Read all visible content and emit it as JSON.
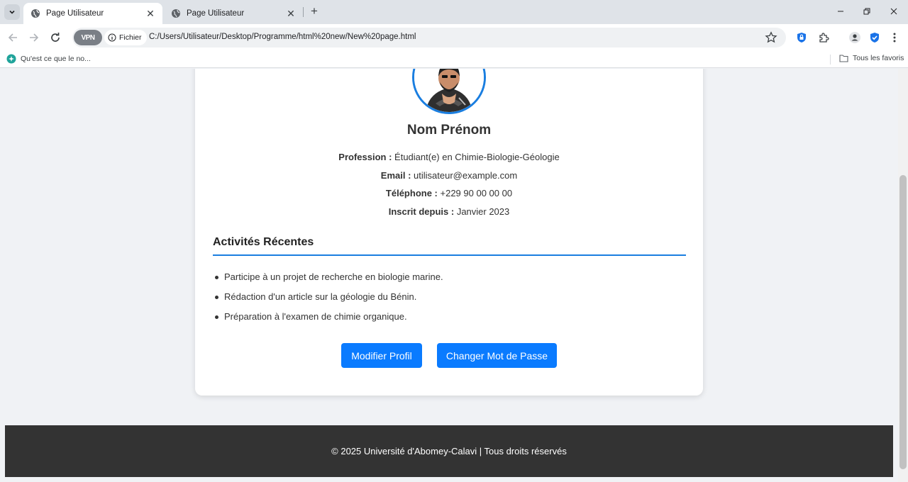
{
  "browser": {
    "tabs": [
      {
        "title": "Page Utilisateur",
        "active": true
      },
      {
        "title": "Page Utilisateur",
        "active": false
      }
    ],
    "address": {
      "vpn_label": "VPN",
      "scheme_label": "Fichier",
      "url": "C:/Users/Utilisateur/Desktop/Programme/html%20new/New%20page.html"
    },
    "bookmarks": {
      "item": "Qu'est ce que le no...",
      "folder": "Tous les favoris"
    },
    "accent_color": "#1a73e8"
  },
  "profile": {
    "name": "Nom Prénom",
    "fields": [
      {
        "label": "Profession :",
        "value": "Étudiant(e) en Chimie-Biologie-Géologie"
      },
      {
        "label": "Email :",
        "value": "utilisateur@example.com"
      },
      {
        "label": "Téléphone :",
        "value": "+229 90 00 00 00"
      },
      {
        "label": "Inscrit depuis :",
        "value": "Janvier 2023"
      }
    ]
  },
  "activities": {
    "title": "Activités Récentes",
    "items": [
      "Participe à un projet de recherche en biologie marine.",
      "Rédaction d'un article sur la géologie du Bénin.",
      "Préparation à l'examen de chimie organique."
    ]
  },
  "actions": {
    "edit_profile": "Modifier Profil",
    "change_password": "Changer Mot de Passe"
  },
  "footer": {
    "text": "© 2025 Université d'Abomey-Calavi | Tous droits réservés"
  },
  "colors": {
    "primary": "#0a7bff",
    "footer_bg": "#333333",
    "page_bg": "#f0f2f5"
  }
}
